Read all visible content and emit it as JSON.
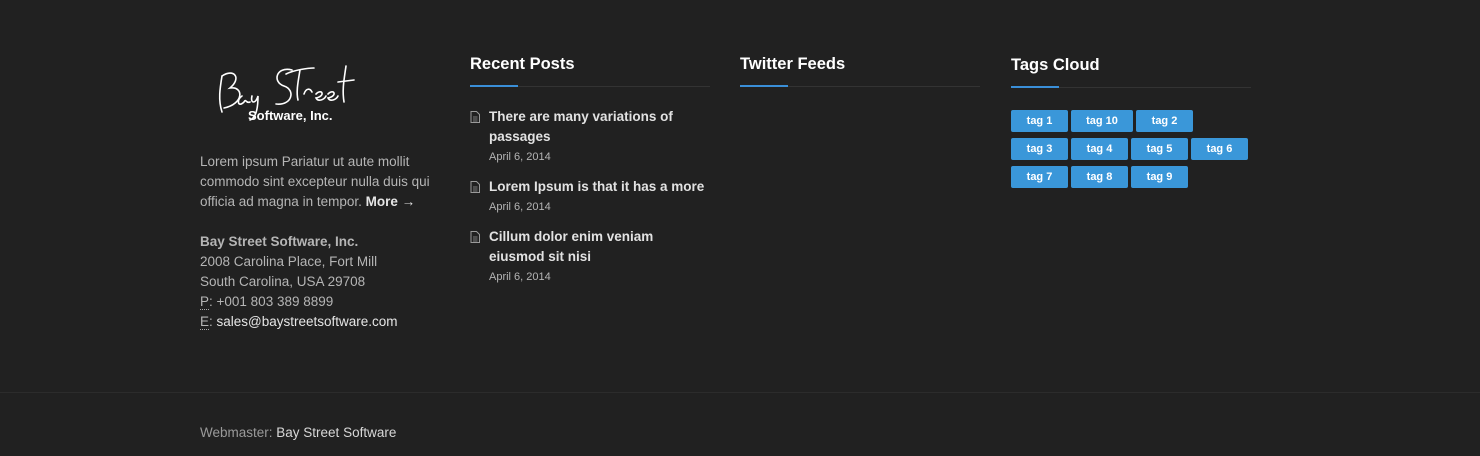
{
  "about": {
    "logo_line1": "Bay Street",
    "logo_line2": "Software, Inc.",
    "text": "Lorem ipsum Pariatur ut aute mollit commodo sint excepteur nulla duis qui officia ad magna in tempor.",
    "more_label": "More →",
    "company": "Bay Street Software, Inc.",
    "address1": "2008 Carolina Place, Fort Mill",
    "address2": "South Carolina, USA 29708",
    "phone_label": "P",
    "phone": ": +001 803 389 8899",
    "email_label": "E",
    "email": "sales@baystreetsoftware.com"
  },
  "recent_posts": {
    "title": "Recent Posts",
    "items": [
      {
        "title": "There are many variations of passages",
        "date": "April 6, 2014"
      },
      {
        "title": "Lorem Ipsum is that it has a more",
        "date": "April 6, 2014"
      },
      {
        "title": "Cillum dolor enim veniam eiusmod sit nisi",
        "date": "April 6, 2014"
      }
    ]
  },
  "twitter": {
    "title": "Twitter Feeds"
  },
  "tags": {
    "title": "Tags Cloud",
    "items": [
      "tag 1",
      "tag 10",
      "tag 2",
      "tag 3",
      "tag 4",
      "tag 5",
      "tag 6",
      "tag 7",
      "tag 8",
      "tag 9"
    ]
  },
  "bottom": {
    "credit_label": "Webmaster: ",
    "credit_link": "Bay Street Software"
  },
  "colors": {
    "background": "#212121",
    "accent": "#3a97d9",
    "text": "#b5b5b5"
  }
}
